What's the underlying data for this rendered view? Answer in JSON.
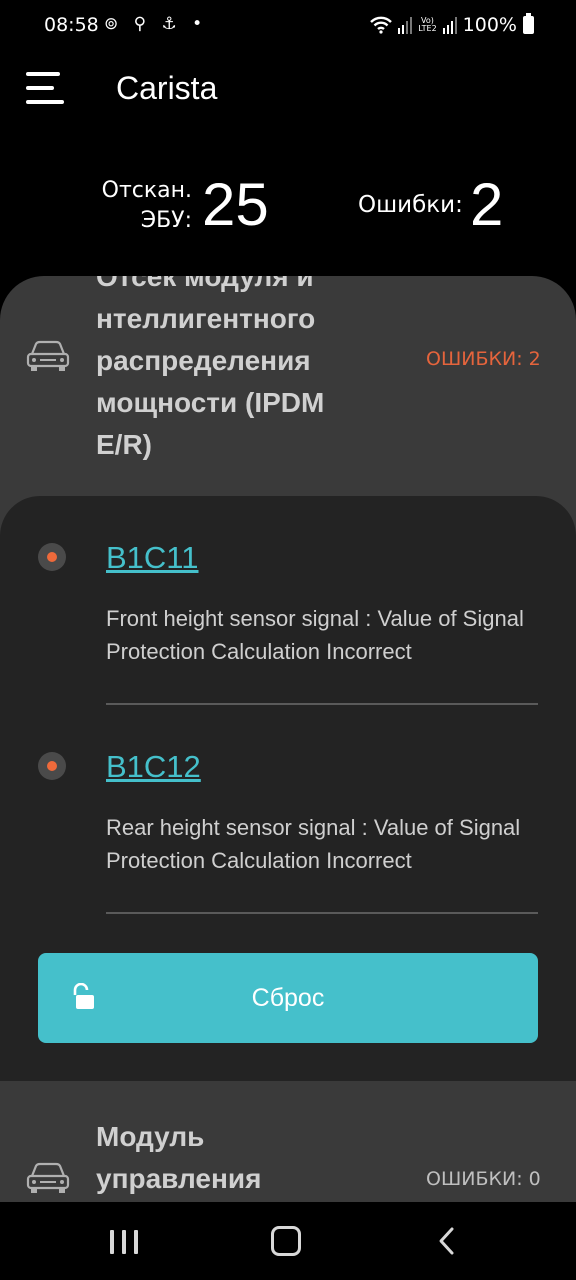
{
  "status_bar": {
    "time": "08:58",
    "left_icons": [
      "whatsapp-icon",
      "search-icon",
      "anchor-icon",
      "dot-icon"
    ],
    "battery": "100%",
    "network": "Vo) LTE2"
  },
  "app_bar": {
    "title": "Carista"
  },
  "summary": {
    "scanned_label": "Отскан. ЭБУ:",
    "scanned_value": "25",
    "errors_label": "Ошибки:",
    "errors_value": "2"
  },
  "ecus": [
    {
      "name": "Отсек модуля интеллигентного распределения мощности (IPDM E/R)",
      "name_visible": "Отсек модуля и нтеллигентного распределения мощности (IPDM E/R)",
      "errors": "ОШИБКИ: 2",
      "dtcs": [
        {
          "code": "B1C11",
          "description": "Front height sensor signal : Value of Signal Protection Calculation Incorrect"
        },
        {
          "code": "B1C12",
          "description": "Rear height sensor signal : Value of Signal Protection Calculation Incorrect"
        }
      ],
      "reset_label": "Сброс"
    },
    {
      "name": "Модуль управления",
      "errors": "ОШИБКИ: 0"
    }
  ],
  "colors": {
    "accent": "#45c0cb",
    "error": "#e5643c",
    "card": "#3a3a3a",
    "inner": "#232323"
  }
}
